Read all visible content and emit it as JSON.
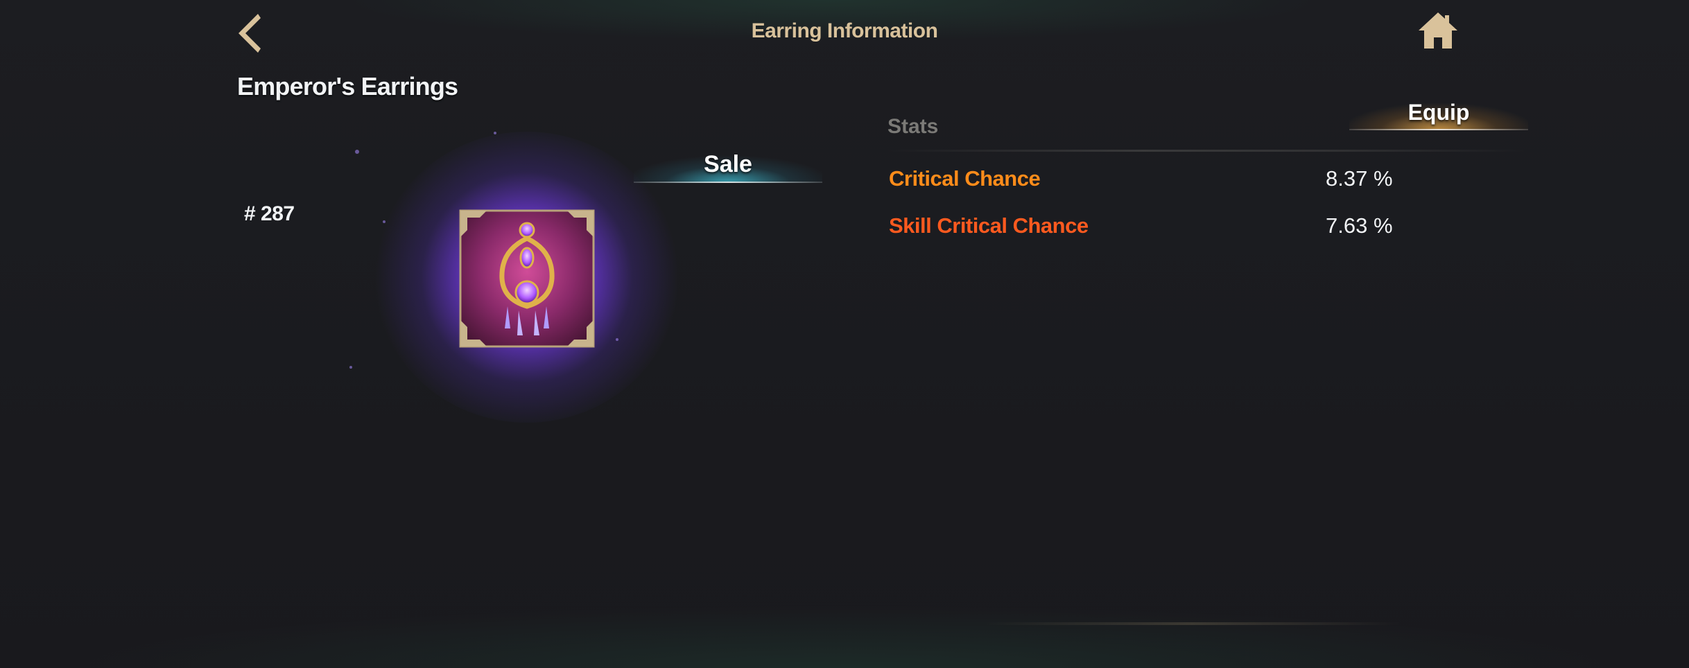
{
  "header": {
    "title": "Earring Information",
    "back_icon": "chevron-left-icon",
    "home_icon": "home-icon",
    "icon_color": "#d9c29b"
  },
  "item": {
    "name": "Emperor's Earrings",
    "rank": "# 287",
    "icon": "emperors-earrings-icon",
    "glow_color": "#8a4dff"
  },
  "actions": {
    "sale_label": "Sale",
    "equip_label": "Equip",
    "sale_color": "#3cb4c8",
    "equip_color": "#dca046"
  },
  "stats": {
    "label": "Stats",
    "rows": [
      {
        "name": "Critical Chance",
        "value": "8.37 %",
        "color": "#ff8c1a"
      },
      {
        "name": "Skill Critical Chance",
        "value": "7.63 %",
        "color": "#ff5a1f"
      }
    ]
  }
}
